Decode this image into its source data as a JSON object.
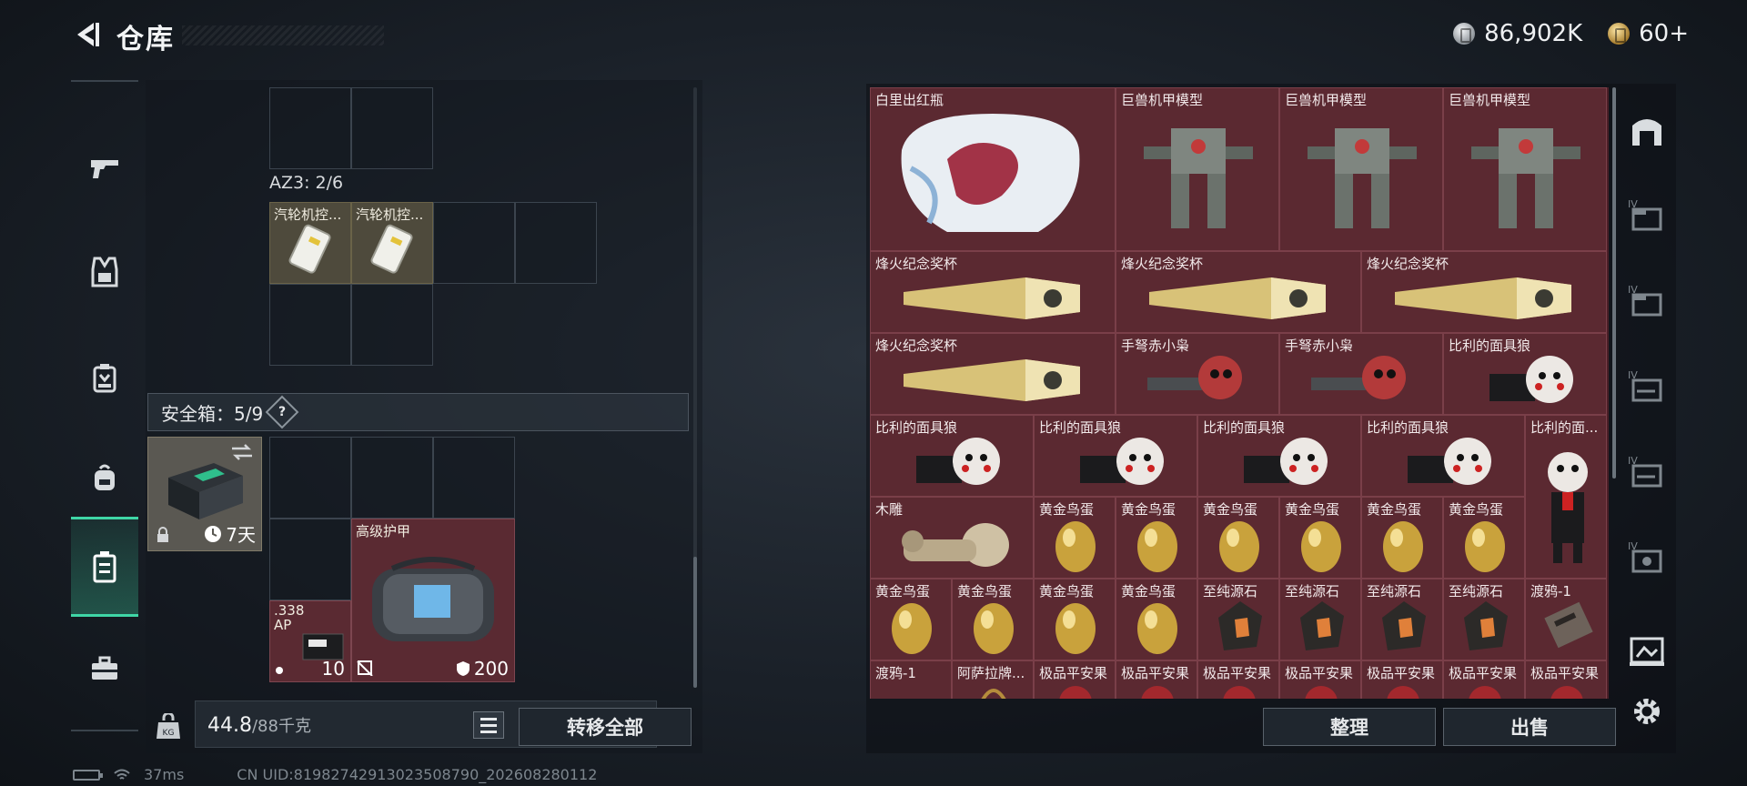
{
  "header": {
    "title": "仓库",
    "silver": "86,902K",
    "gold": "60+"
  },
  "left_nav": [
    {
      "name": "weapons"
    },
    {
      "name": "armor"
    },
    {
      "name": "backpack"
    },
    {
      "name": "bag"
    },
    {
      "name": "safebox"
    },
    {
      "name": "toolbox"
    }
  ],
  "storage": {
    "az3_label": "AZ3: 2/6",
    "az3_items": [
      "汽轮机控...",
      "汽轮机控..."
    ]
  },
  "safebox": {
    "label": "安全箱：5/9",
    "help": "?",
    "days": "7天",
    "ammo_label": ".338 AP",
    "ammo_count": "10",
    "armor_label": "高级护甲",
    "armor_value": "200"
  },
  "footer_left": {
    "weight": "44.8",
    "weight_max": "/88千克",
    "transfer_all": "转移全部"
  },
  "inventory": {
    "rows": [
      [
        "白里出红瓶",
        "巨兽机甲模型",
        "巨兽机甲模型",
        "巨兽机甲模型"
      ],
      [
        "烽火纪念奖杯",
        "烽火纪念奖杯",
        "烽火纪念奖杯"
      ],
      [
        "烽火纪念奖杯",
        "手弩赤小枭",
        "手弩赤小枭",
        "比利的面具狼"
      ],
      [
        "比利的面具狼",
        "比利的面具狼",
        "比利的面具狼",
        "比利的面具狼",
        "比利的面..."
      ],
      [
        "木雕",
        "黄金鸟蛋",
        "黄金鸟蛋",
        "黄金鸟蛋",
        "黄金鸟蛋",
        "黄金鸟蛋",
        "黄金鸟蛋"
      ],
      [
        "黄金鸟蛋",
        "黄金鸟蛋",
        "黄金鸟蛋",
        "黄金鸟蛋",
        "至纯源石",
        "至纯源石",
        "至纯源石",
        "至纯源石",
        "渡鸦-1"
      ],
      [
        "渡鸦-1",
        "阿萨拉牌...",
        "极品平安果",
        "极品平安果",
        "极品平安果",
        "极品平安果",
        "极品平安果",
        "极品平安果",
        "极品平安果"
      ]
    ],
    "sort": "整理",
    "sell": "出售"
  },
  "status": {
    "ping": "37ms",
    "uid": "CN UID:81982742913023508790_202608280112"
  },
  "colors": {
    "accent": "#3fd6a6",
    "cell_red": "#5b2931",
    "cell_gold": "#4e4a3c"
  }
}
